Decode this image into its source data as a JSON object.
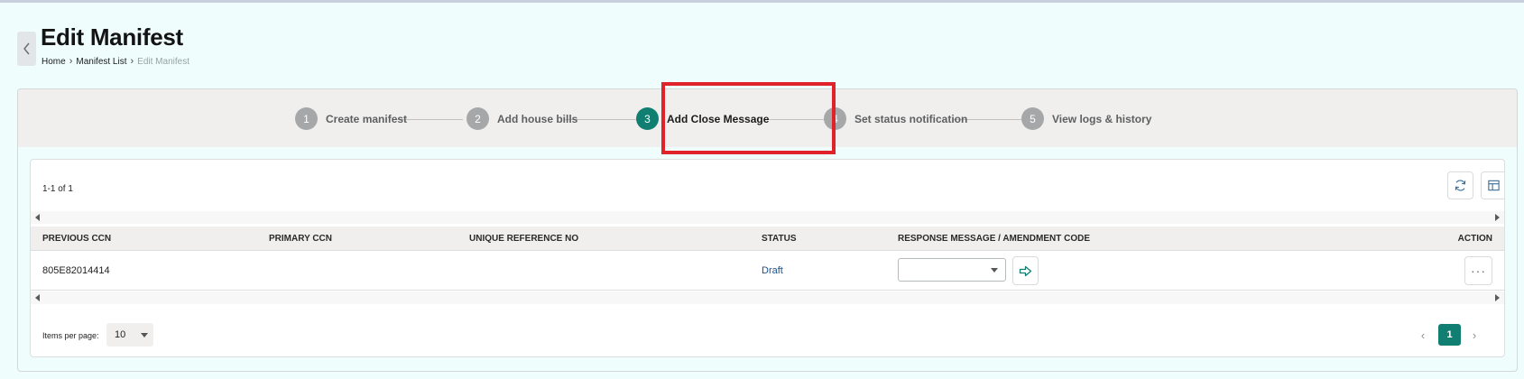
{
  "header": {
    "title": "Edit Manifest",
    "breadcrumb": [
      {
        "label": "Home"
      },
      {
        "label": "Manifest List"
      },
      {
        "label": "Edit Manifest"
      }
    ]
  },
  "stepper": {
    "steps": [
      {
        "number": "1",
        "label": "Create manifest",
        "active": false
      },
      {
        "number": "2",
        "label": "Add house bills",
        "active": false
      },
      {
        "number": "3",
        "label": "Add Close Message",
        "active": true
      },
      {
        "number": "4",
        "label": "Set status notification",
        "active": false
      },
      {
        "number": "5",
        "label": "View logs & history",
        "active": false
      }
    ]
  },
  "table": {
    "record_count": "1-1 of 1",
    "columns": [
      "PREVIOUS CCN",
      "PRIMARY CCN",
      "UNIQUE REFERENCE NO",
      "STATUS",
      "RESPONSE MESSAGE / AMENDMENT CODE",
      "ACTION"
    ],
    "rows": [
      {
        "previous_ccn": "805E82014414",
        "primary_ccn": "",
        "unique_reference_no": "",
        "status": "Draft",
        "response_message": ""
      }
    ]
  },
  "pagination": {
    "items_per_page_label": "Items per page:",
    "items_per_page": "10",
    "current_page": "1"
  },
  "icons": {
    "back": "chevron-left-icon",
    "refresh": "refresh-icon",
    "columns": "layout-columns-icon",
    "go": "arrow-right-icon",
    "more": "more-horizontal-icon"
  },
  "colors": {
    "accent": "#117e72",
    "highlight": "#e0232b",
    "status_link": "#1c4f86",
    "background": "#effdfd"
  }
}
